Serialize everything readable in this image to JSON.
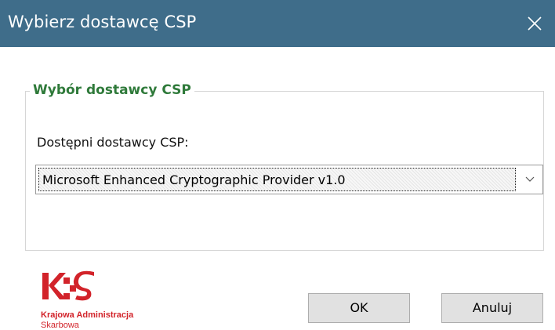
{
  "window": {
    "title": "Wybierz dostawcę CSP",
    "titlebar_color": "#3f6d8a",
    "close_icon": "close-icon"
  },
  "group": {
    "legend": "Wybór dostawcy CSP",
    "legend_color": "#2f7a3a"
  },
  "provider": {
    "label": "Dostępni dostawcy CSP:",
    "selected": "Microsoft Enhanced Cryptographic Provider v1.0",
    "dropdown_icon": "chevron-down-icon"
  },
  "logo": {
    "mark": "KAS",
    "line1": "Krajowa Administracja",
    "line2": "Skarbowa",
    "brand_color": "#d2232a"
  },
  "buttons": {
    "ok": "OK",
    "cancel": "Anuluj"
  }
}
